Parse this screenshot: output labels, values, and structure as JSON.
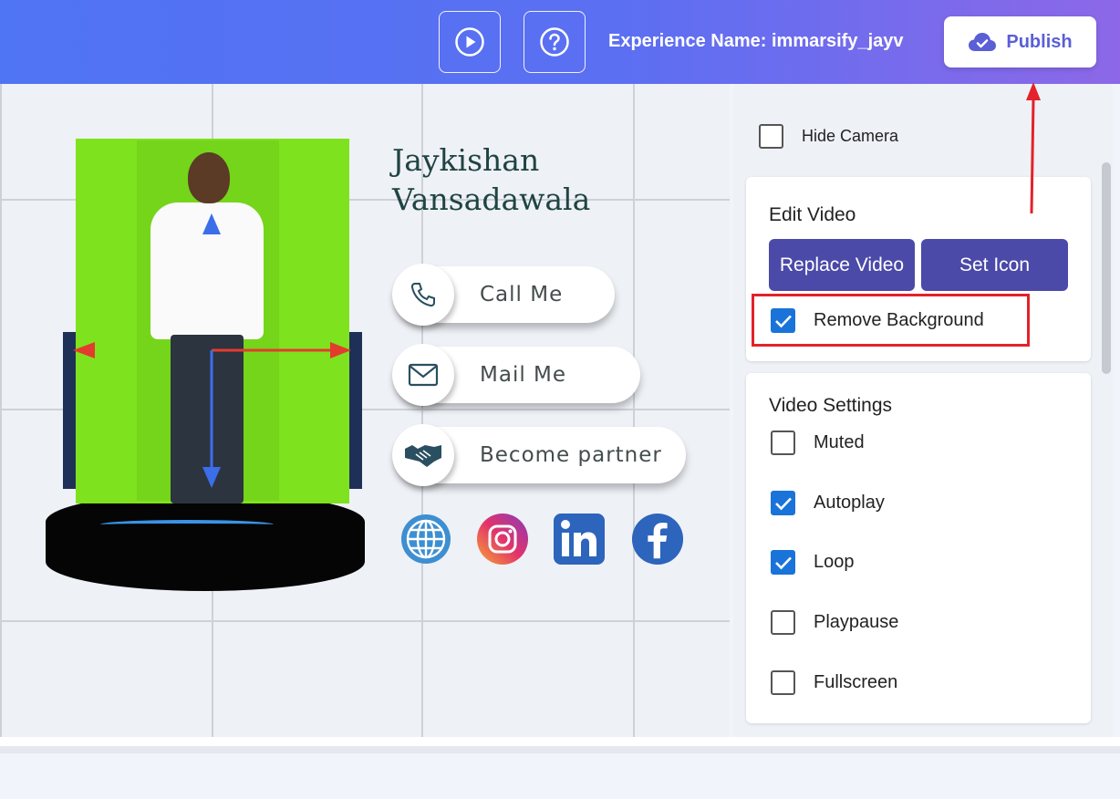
{
  "header": {
    "play_icon": "play-circle-icon",
    "help_icon": "question-circle-icon",
    "experience_name": "Experience Name: immarsify_jayv",
    "publish_label": "Publish",
    "publish_icon": "cloud-check-icon"
  },
  "canvas": {
    "name_line1": "Jaykishan",
    "name_line2": "Vansadawala",
    "actions": [
      {
        "label": "Call Me",
        "icon": "phone-icon"
      },
      {
        "label": "Mail Me",
        "icon": "mail-icon"
      },
      {
        "label": "Become partner",
        "icon": "handshake-icon"
      }
    ],
    "socials": [
      "globe-icon",
      "instagram-icon",
      "linkedin-icon",
      "facebook-icon"
    ]
  },
  "side": {
    "hide_camera": {
      "label": "Hide Camera",
      "checked": false
    },
    "edit_video": {
      "title": "Edit Video",
      "replace_label": "Replace Video",
      "set_icon_label": "Set Icon",
      "remove_bg": {
        "label": "Remove Background",
        "checked": true
      }
    },
    "video_settings": {
      "title": "Video Settings",
      "options": [
        {
          "label": "Muted",
          "checked": false
        },
        {
          "label": "Autoplay",
          "checked": true
        },
        {
          "label": "Loop",
          "checked": true
        },
        {
          "label": "Playpause",
          "checked": false
        },
        {
          "label": "Fullscreen",
          "checked": false
        }
      ]
    }
  },
  "colors": {
    "accent_purple": "#4b4aa8",
    "checkbox_blue": "#1a73d9",
    "annotation_red": "#e3222b"
  }
}
